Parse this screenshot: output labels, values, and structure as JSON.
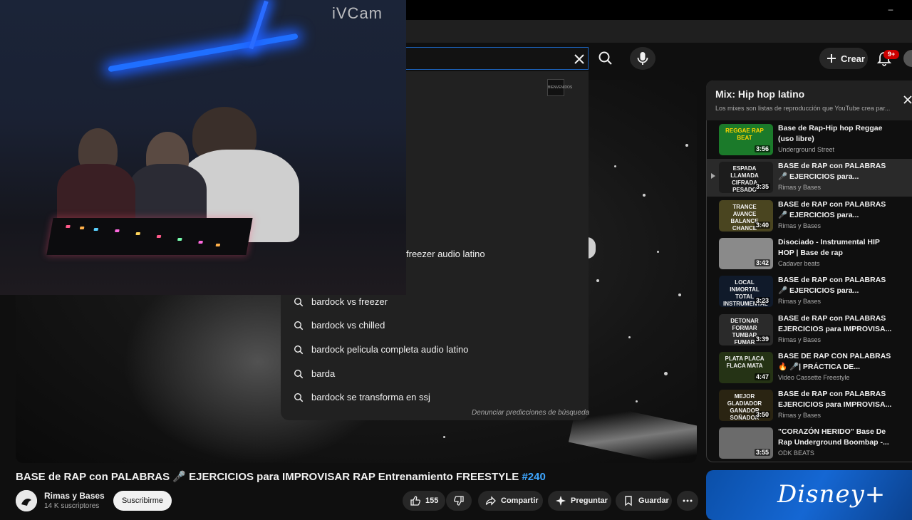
{
  "camera": {
    "watermark": "iVCam"
  },
  "header": {
    "create_label": "Crear",
    "notification_badge": "9+"
  },
  "search": {
    "dropdown_thumb_text": "BIENVENIDOS",
    "suggestions": [
      "freezer audio latino",
      "bardock vs freezer",
      "bardock vs chilled",
      "bardock pelicula completa audio latino",
      "barda",
      "bardock se transforma en ssj"
    ],
    "report_link": "Denunciar predicciones de búsqueda"
  },
  "video": {
    "title": "BASE de RAP con PALABRAS 🎤 EJERCICIOS para IMPROVISAR RAP Entrenamiento FREESTYLE",
    "hashtag": "#240",
    "channel": "Rimas y Bases",
    "subscribers": "14 K suscriptores",
    "subscribe_label": "Suscribirme",
    "likes": "155",
    "share_label": "Compartir",
    "ask_label": "Preguntar",
    "save_label": "Guardar"
  },
  "mix": {
    "title": "Mix: Hip hop latino",
    "subtitle": "Los mixes son listas de reproducción que YouTube crea par...",
    "items": [
      {
        "title": "Base de Rap-Hip hop Reggae (uso libre)",
        "channel": "Underground Street",
        "duration": "3:56",
        "thumb_text": "REGGAE RAP BEAT",
        "thumb_bg": "#1b7a2a",
        "thumb_color": "#ffd400"
      },
      {
        "title": "BASE de RAP con PALABRAS 🎤 EJERCICIOS para...",
        "channel": "Rimas y Bases",
        "duration": "3:35",
        "thumb_text": "ESPADA LLAMADA CIFRADA PESADO",
        "thumb_bg": "#1c1c1c",
        "thumb_color": "#f1f1f1"
      },
      {
        "title": "BASE de RAP con PALABRAS 🎤 EJERCICIOS para...",
        "channel": "Rimas y Bases",
        "duration": "3:40",
        "thumb_text": "TRANCE AVANCE BALANCE CHANCE",
        "thumb_bg": "#4a4520",
        "thumb_color": "#f1f1f1"
      },
      {
        "title": "Disociado - Instrumental HIP HOP | Base de rap undergroun...",
        "channel": "Cadaver beats",
        "duration": "3:42",
        "thumb_text": "",
        "thumb_bg": "#8a8a8a",
        "thumb_color": "#f1f1f1"
      },
      {
        "title": "BASE de RAP con PALABRAS 🎤 EJERCICIOS para...",
        "channel": "Rimas y Bases",
        "duration": "3:23",
        "thumb_text": "LOCAL INMORTAL TOTAL INSTRUMENTAL",
        "thumb_bg": "#101a2a",
        "thumb_color": "#f1f1f1"
      },
      {
        "title": "BASE de RAP con PALABRAS EJERCICIOS para IMPROVISA...",
        "channel": "Rimas y Bases",
        "duration": "3:39",
        "thumb_text": "DETONAR FORMAR TUMBAR FUMAR",
        "thumb_bg": "#2a2a2a",
        "thumb_color": "#f1f1f1"
      },
      {
        "title": "BASE DE RAP CON PALABRAS 🔥 🎤| PRÁCTICA DE...",
        "channel": "Video Cassette Freestyle",
        "duration": "4:47",
        "thumb_text": "PLATA PLACA FLACA MATA",
        "thumb_bg": "#253315",
        "thumb_color": "#f1f1f1"
      },
      {
        "title": "BASE de RAP con PALABRAS EJERCICIOS para IMPROVISA...",
        "channel": "Rimas y Bases",
        "duration": "3:50",
        "thumb_text": "MEJOR GLADIADOR GANADOR SOÑADOR",
        "thumb_bg": "#2a2412",
        "thumb_color": "#f1f1f1"
      },
      {
        "title": "\"CORAZÓN HERIDO\" Base De Rap Underground Boombap -...",
        "channel": "ODK BEATS",
        "duration": "3:55",
        "thumb_text": "",
        "thumb_bg": "#6b6b6b",
        "thumb_color": "#f1f1f1"
      }
    ]
  },
  "ad": {
    "brand": "Disney+"
  },
  "colors": {
    "accent_blue": "#3ea6ff",
    "focus_border": "#1c62b9",
    "badge_red": "#cc0000"
  }
}
